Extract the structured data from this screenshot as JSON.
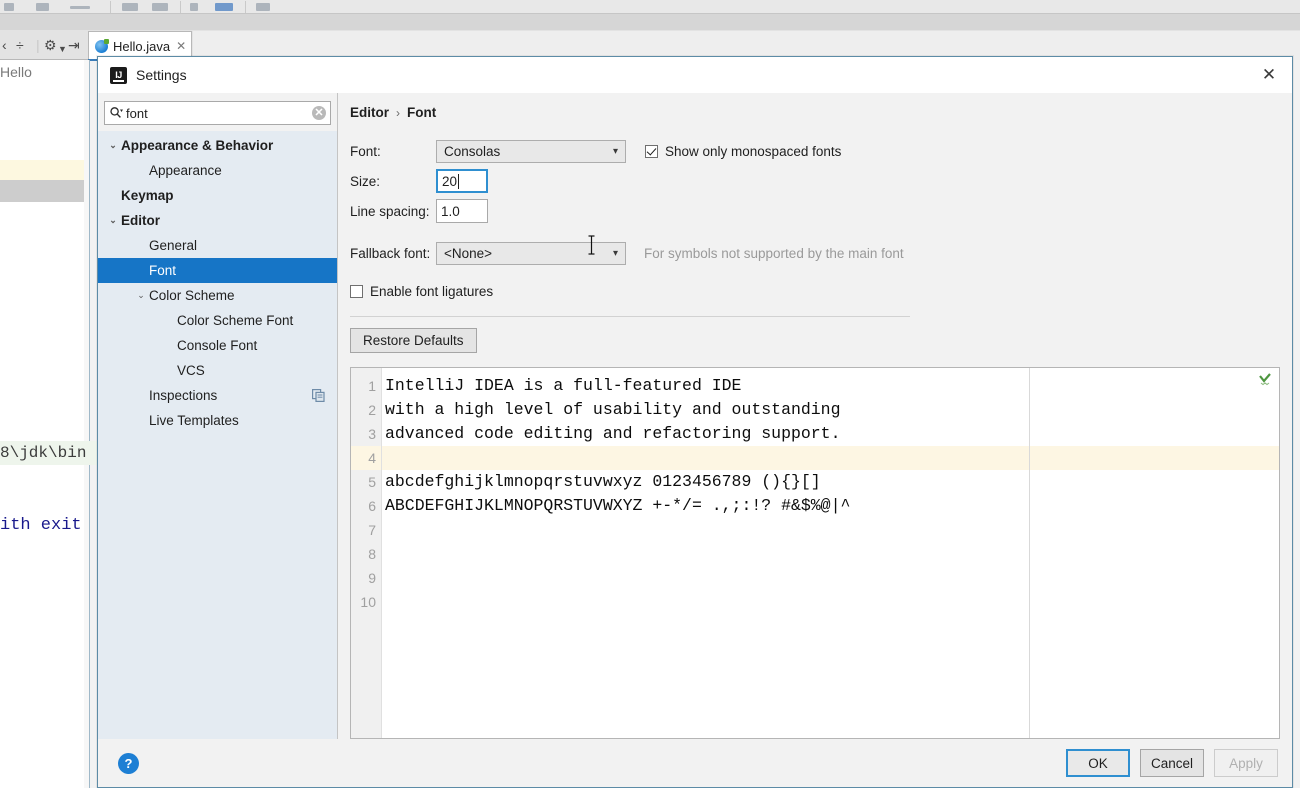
{
  "ide": {
    "tab": {
      "label": "Hello.java",
      "close_icon": "close-icon",
      "file_icon": "java-class-icon"
    },
    "left_editor": {
      "text_fragment": "Hello",
      "console_line_1": "8\\jdk\\bin",
      "console_line_2": "ith exit"
    }
  },
  "dialog": {
    "title": "Settings",
    "logo_icon": "intellij-idea-logo-icon",
    "close_icon": "close-icon"
  },
  "search": {
    "value": "font",
    "placeholder": "",
    "search_icon": "search-dropdown-icon",
    "clear_icon": "clear-icon"
  },
  "sidebar": {
    "items": [
      {
        "label": "Appearance & Behavior",
        "indent": 0,
        "arrow": "⌄",
        "bold": true,
        "selected": false,
        "name": "sidebar-item-appearance-behavior"
      },
      {
        "label": "Appearance",
        "indent": 1,
        "arrow": "",
        "bold": false,
        "selected": false,
        "name": "sidebar-item-appearance"
      },
      {
        "label": "Keymap",
        "indent": 0,
        "arrow": "",
        "bold": true,
        "selected": false,
        "name": "sidebar-item-keymap"
      },
      {
        "label": "Editor",
        "indent": 0,
        "arrow": "⌄",
        "bold": true,
        "selected": false,
        "name": "sidebar-item-editor"
      },
      {
        "label": "General",
        "indent": 1,
        "arrow": "",
        "bold": false,
        "selected": false,
        "name": "sidebar-item-general"
      },
      {
        "label": "Font",
        "indent": 1,
        "arrow": "",
        "bold": false,
        "selected": true,
        "name": "sidebar-item-font"
      },
      {
        "label": "Color Scheme",
        "indent": 1,
        "arrow": "⌄",
        "bold": false,
        "selected": false,
        "name": "sidebar-item-color-scheme"
      },
      {
        "label": "Color Scheme Font",
        "indent": 2,
        "arrow": "",
        "bold": false,
        "selected": false,
        "name": "sidebar-item-color-scheme-font"
      },
      {
        "label": "Console Font",
        "indent": 2,
        "arrow": "",
        "bold": false,
        "selected": false,
        "name": "sidebar-item-console-font"
      },
      {
        "label": "VCS",
        "indent": 2,
        "arrow": "",
        "bold": false,
        "selected": false,
        "name": "sidebar-item-vcs"
      },
      {
        "label": "Inspections",
        "indent": 1,
        "arrow": "",
        "bold": false,
        "selected": false,
        "name": "sidebar-item-inspections",
        "right_icon": "copy-icon"
      },
      {
        "label": "Live Templates",
        "indent": 1,
        "arrow": "",
        "bold": false,
        "selected": false,
        "name": "sidebar-item-live-templates"
      }
    ]
  },
  "breadcrumb": {
    "root": "Editor",
    "separator": "›",
    "leaf": "Font"
  },
  "form": {
    "font_label": "Font:",
    "font_value": "Consolas",
    "show_monospaced_label": "Show only monospaced fonts",
    "show_monospaced_checked": true,
    "size_label": "Size:",
    "size_value": "20",
    "line_spacing_label": "Line spacing:",
    "line_spacing_value": "1.0",
    "fallback_label": "Fallback font:",
    "fallback_value": "<None>",
    "fallback_hint": "For symbols not supported by the main font",
    "ligatures_label": "Enable font ligatures",
    "ligatures_checked": false,
    "restore_defaults_label": "Restore Defaults"
  },
  "preview": {
    "line_numbers": [
      "1",
      "2",
      "3",
      "4",
      "5",
      "6",
      "7",
      "8",
      "9",
      "10"
    ],
    "lines": [
      "IntelliJ IDEA is a full-featured IDE",
      "with a high level of usability and outstanding",
      "advanced code editing and refactoring support.",
      "",
      "abcdefghijklmnopqrstuvwxyz 0123456789 (){}[]",
      "ABCDEFGHIJKLMNOPQRSTUVWXYZ +-*/= .,;:!? #&$%@|^",
      "",
      "",
      "",
      ""
    ],
    "caret_line_index": 3,
    "inspection_icon": "inspection-ok-checkmark-icon"
  },
  "footer": {
    "help_label": "?",
    "ok_label": "OK",
    "cancel_label": "Cancel",
    "apply_label": "Apply",
    "apply_disabled": true
  },
  "colors": {
    "selection_blue": "#1675c6",
    "focus_blue": "#2f8fd0",
    "sidebar_bg": "#e4ebf2",
    "dialog_bg": "#f2f2f2",
    "caret_line": "#fdf6e3",
    "inspection_green": "#5a9a3c",
    "help_blue": "#1d7fd4"
  }
}
